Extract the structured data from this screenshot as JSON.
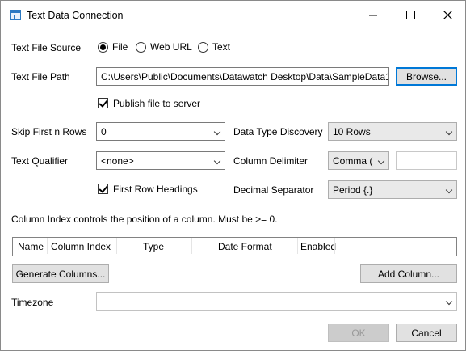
{
  "window": {
    "title": "Text Data Connection",
    "controls": {
      "minimize": "minimize-icon",
      "maximize": "maximize-icon",
      "close": "close-icon"
    }
  },
  "source": {
    "label": "Text File Source",
    "options": [
      "File",
      "Web URL",
      "Text"
    ],
    "selected": "File"
  },
  "path": {
    "label": "Text File Path",
    "value": "C:\\Users\\Public\\Documents\\Datawatch Desktop\\Data\\SampleData1",
    "browse_label": "Browse..."
  },
  "publish": {
    "label": "Publish file to server",
    "checked": true
  },
  "skip_rows": {
    "label": "Skip First n Rows",
    "value": "0"
  },
  "type_discovery": {
    "label": "Data Type Discovery",
    "value": "10 Rows"
  },
  "qualifier": {
    "label": "Text Qualifier",
    "value": "<none>"
  },
  "delimiter": {
    "label": "Column Delimiter",
    "value": "Comma (",
    "custom_value": ""
  },
  "first_row": {
    "label": "First Row Headings",
    "checked": true
  },
  "decimal": {
    "label": "Decimal Separator",
    "value": "Period {.}"
  },
  "info_text": "Column Index controls the position of a column. Must be >= 0.",
  "grid": {
    "columns": [
      "Name",
      "Column Index",
      "Type",
      "Date Format",
      "Enabled"
    ]
  },
  "buttons": {
    "generate": "Generate Columns...",
    "add_column": "Add Column...",
    "ok": "OK",
    "cancel": "Cancel"
  },
  "timezone": {
    "label": "Timezone",
    "value": ""
  },
  "colors": {
    "focus_accent": "#0078d7",
    "button_face": "#e1e1e1"
  }
}
